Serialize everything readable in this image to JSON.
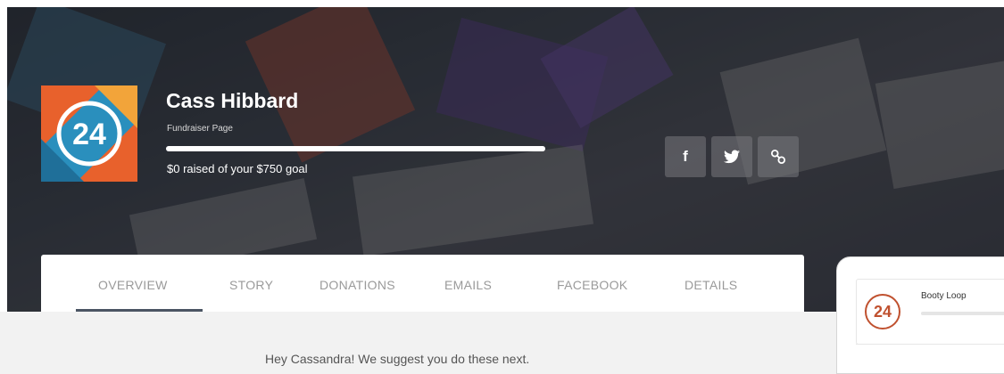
{
  "fundraiser": {
    "name": "Cass Hibbard",
    "page_type": "Fundraiser Page",
    "raised_text": "$0 raised of your $750 goal",
    "progress_fraction": 1.0
  },
  "logo": {
    "text": "24"
  },
  "social": {
    "facebook_icon": "f",
    "twitter_icon": "twitter-icon",
    "link_icon": "link-icon"
  },
  "tabs": [
    {
      "label": "OVERVIEW"
    },
    {
      "label": "STORY"
    },
    {
      "label": "DONATIONS"
    },
    {
      "label": "EMAILS"
    },
    {
      "label": "FACEBOOK"
    },
    {
      "label": "DETAILS"
    }
  ],
  "suggestion": "Hey Cassandra! We suggest you do these next.",
  "side_panel": {
    "logo_text": "24",
    "name": "Booty Loop"
  },
  "colors": {
    "accent": "#4b5563",
    "logo_orange": "#e8612c",
    "logo_blue": "#2a8fbd"
  }
}
